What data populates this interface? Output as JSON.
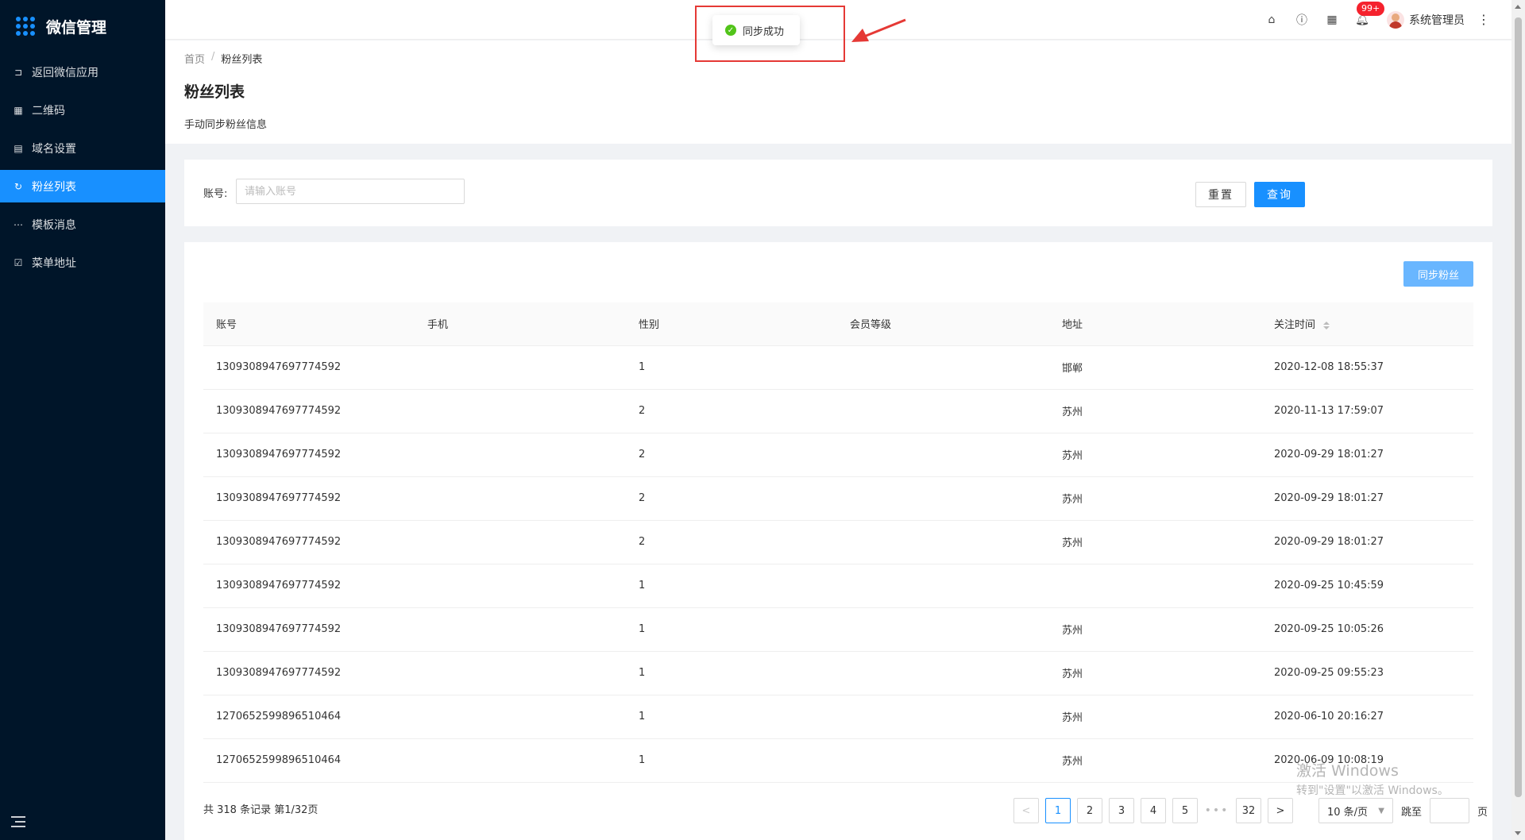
{
  "sidebar": {
    "brand_icon": "apps-grid-icon",
    "title": "微信管理",
    "items": [
      {
        "label": "返回微信应用",
        "icon": "return-icon"
      },
      {
        "label": "二维码",
        "icon": "qrcode-icon"
      },
      {
        "label": "域名设置",
        "icon": "document-icon"
      },
      {
        "label": "粉丝列表",
        "icon": "sync-icon",
        "active": true
      },
      {
        "label": "模板消息",
        "icon": "message-icon"
      },
      {
        "label": "菜单地址",
        "icon": "checklist-icon"
      }
    ]
  },
  "header": {
    "icons": [
      "home-icon",
      "help-icon",
      "apps-icon",
      "bell-icon"
    ],
    "notification_badge": "99+",
    "user_name": "系统管理员"
  },
  "breadcrumb": {
    "home": "首页",
    "current": "粉丝列表"
  },
  "page": {
    "title": "粉丝列表",
    "description": "手动同步粉丝信息"
  },
  "search": {
    "label": "账号:",
    "placeholder": "请输入账号",
    "reset_label": "重置",
    "query_label": "查询"
  },
  "sync_button_label": "同步粉丝",
  "table": {
    "columns": [
      "账号",
      "手机",
      "性别",
      "会员等级",
      "地址",
      "关注时间"
    ],
    "rows": [
      [
        "1309308947697774592",
        "",
        "1",
        "",
        "邯郸",
        "2020-12-08 18:55:37"
      ],
      [
        "1309308947697774592",
        "",
        "2",
        "",
        "苏州",
        "2020-11-13 17:59:07"
      ],
      [
        "1309308947697774592",
        "",
        "2",
        "",
        "苏州",
        "2020-09-29 18:01:27"
      ],
      [
        "1309308947697774592",
        "",
        "2",
        "",
        "苏州",
        "2020-09-29 18:01:27"
      ],
      [
        "1309308947697774592",
        "",
        "2",
        "",
        "苏州",
        "2020-09-29 18:01:27"
      ],
      [
        "1309308947697774592",
        "",
        "1",
        "",
        "",
        "2020-09-25 10:45:59"
      ],
      [
        "1309308947697774592",
        "",
        "1",
        "",
        "苏州",
        "2020-09-25 10:05:26"
      ],
      [
        "1309308947697774592",
        "",
        "1",
        "",
        "苏州",
        "2020-09-25 09:55:23"
      ],
      [
        "1270652599896510464",
        "",
        "1",
        "",
        "苏州",
        "2020-06-10 20:16:27"
      ],
      [
        "1270652599896510464",
        "",
        "1",
        "",
        "苏州",
        "2020-06-09 10:08:19"
      ]
    ]
  },
  "pagination": {
    "total_text": "共 318 条记录 第1/32页",
    "pages": [
      "1",
      "2",
      "3",
      "4",
      "5"
    ],
    "ellipsis": "•••",
    "last_page": "32",
    "prev": "<",
    "next": ">",
    "page_size": "10 条/页",
    "jump_label": "跳至",
    "page_suffix": "页"
  },
  "toast": {
    "message": "同步成功",
    "icon": "check-circle-icon"
  },
  "watermark": {
    "title": "激活 Windows",
    "subtitle": "转到\"设置\"以激活 Windows。"
  },
  "colors": {
    "primary": "#1890ff",
    "sidebar_bg": "#001529",
    "success": "#52c41a",
    "badge": "#f5222d",
    "annotation": "#e53935"
  }
}
